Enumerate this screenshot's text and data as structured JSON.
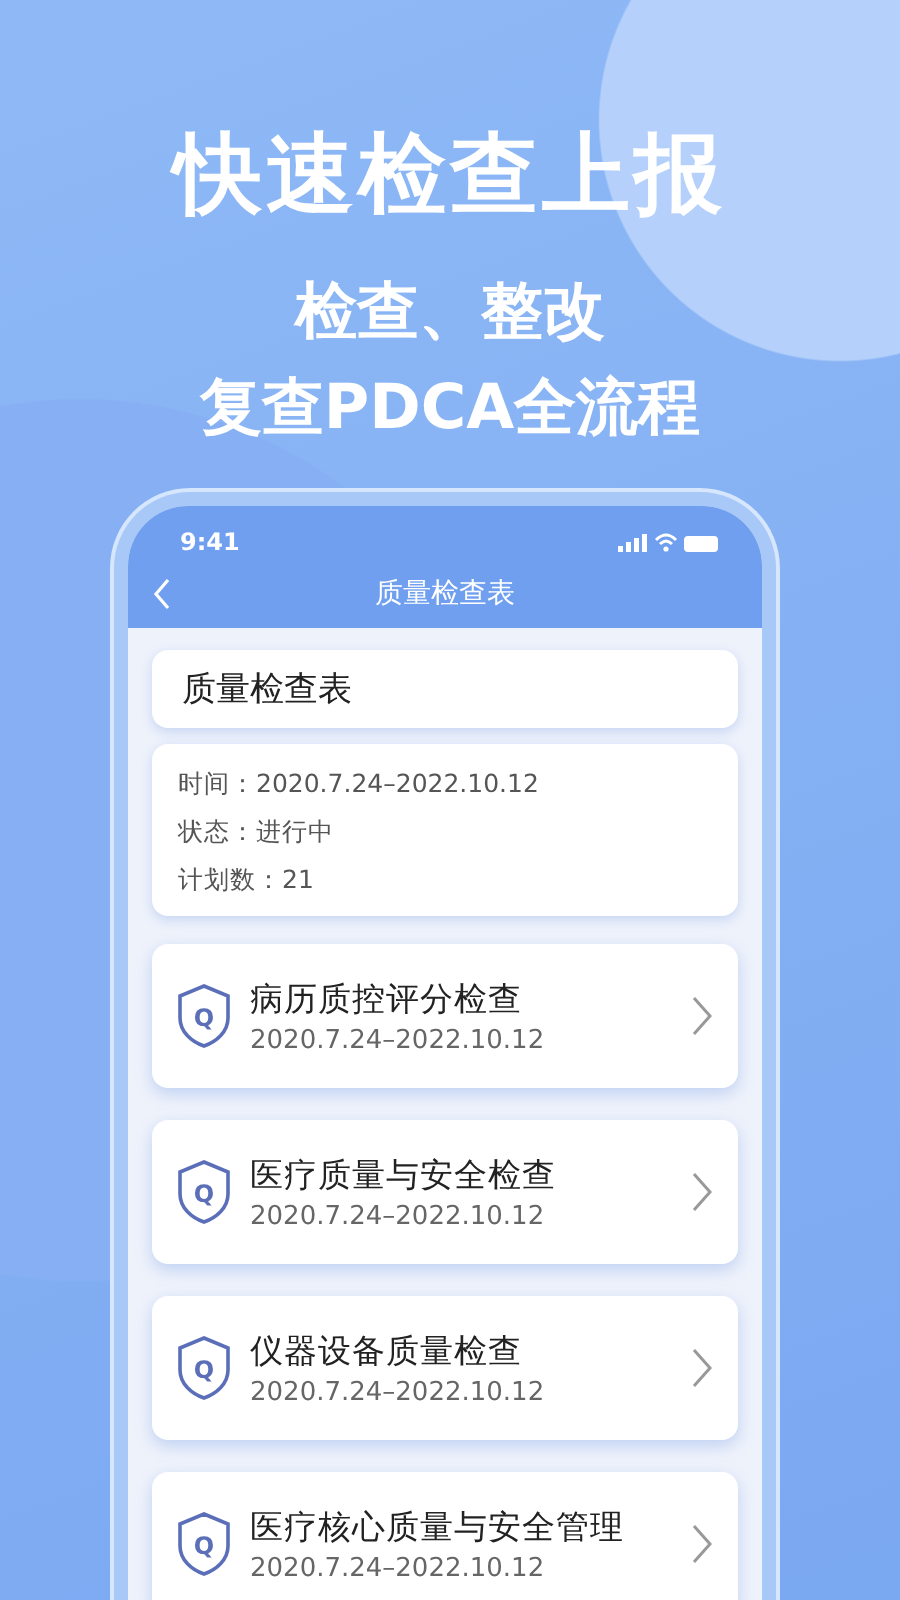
{
  "headline": "快速检查上报",
  "taglines": [
    "检查、整改",
    "复查PDCA全流程"
  ],
  "status_bar": {
    "time": "9:41"
  },
  "nav_bar": {
    "title": "质量检查表"
  },
  "form_title": "质量检查表",
  "summary": [
    "时间：2020.7.24–2022.10.12",
    "状态：进行中",
    "计划数：21"
  ],
  "items": [
    {
      "title": "病历质控评分检查",
      "date": "2020.7.24–2022.10.12",
      "badge": "Q"
    },
    {
      "title": "医疗质量与安全检查",
      "date": "2020.7.24–2022.10.12",
      "badge": "Q"
    },
    {
      "title": "仪器设备质量检查",
      "date": "2020.7.24–2022.10.12",
      "badge": "Q"
    },
    {
      "title": "医疗核心质量与安全管理",
      "date": "2020.7.24–2022.10.12",
      "badge": "Q"
    }
  ]
}
